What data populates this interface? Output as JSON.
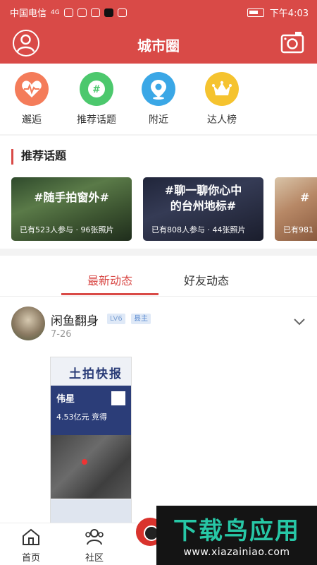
{
  "status_bar": {
    "carrier": "中国电信",
    "network": "4G",
    "time": "下午4:03"
  },
  "header": {
    "title": "城市圈"
  },
  "quick_menu": [
    {
      "label": "邂逅",
      "icon": "heart-pulse-icon",
      "color": "#f47c5a"
    },
    {
      "label": "推荐话题",
      "icon": "hashtag-icon",
      "color": "#4cc86d"
    },
    {
      "label": "附近",
      "icon": "location-pin-icon",
      "color": "#3aa7e6"
    },
    {
      "label": "达人榜",
      "icon": "crown-icon",
      "color": "#f5c32f"
    }
  ],
  "topics": {
    "title": "推荐话题",
    "cards": [
      {
        "title": "#随手拍窗外#",
        "meta": "已有523人参与 · 96张照片"
      },
      {
        "title": "#聊一聊你心中的台州地标#",
        "meta": "已有808人参与 · 44张照片"
      },
      {
        "title": "#",
        "meta": "已有981"
      }
    ]
  },
  "tabs": [
    {
      "label": "最新动态",
      "active": true
    },
    {
      "label": "好友动态",
      "active": false
    }
  ],
  "post": {
    "author": "闲鱼翻身",
    "level": "LV6",
    "role": "县主",
    "date": "7-26",
    "image": {
      "masthead": "土拍快报",
      "name": "伟星",
      "price": "4.53亿元 竞得"
    }
  },
  "bottom_nav": [
    {
      "label": "首页",
      "icon": "home-icon"
    },
    {
      "label": "社区",
      "icon": "community-icon"
    }
  ],
  "watermark": {
    "text": "下载鸟应用",
    "url": "www.xiazainiao.com"
  },
  "colors": {
    "brand_red": "#d94a47",
    "watermark_green": "#27c7a6"
  }
}
